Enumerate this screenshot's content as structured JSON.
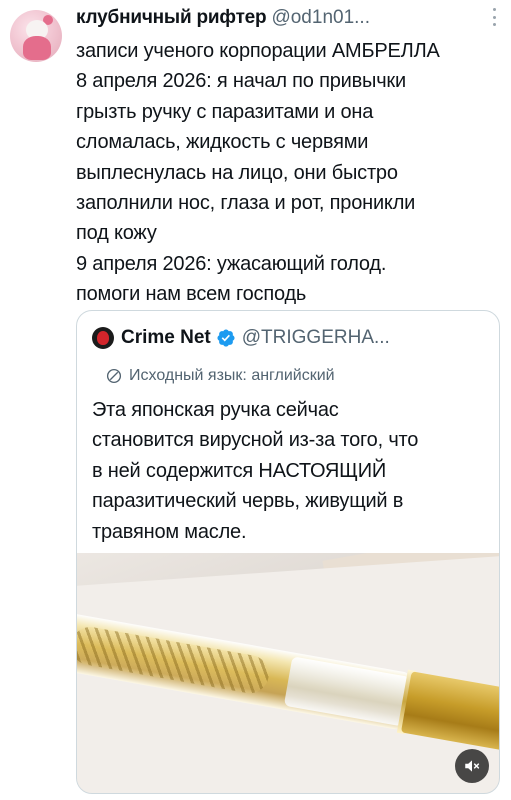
{
  "tweet": {
    "author_name": "клубничный рифтер",
    "author_handle": "@od1n01...",
    "text_lines": [
      "записи ученого корпорации АМБРЕЛЛА",
      "8 апреля 2026: я начал по привычки",
      "грызть ручку с паразитами и она",
      "сломалась, жидкость с червями",
      "выплеснулась на лицо, они быстро",
      "заполнили нос, глаза и рот, проникли",
      "под кожу",
      "9 апреля 2026: ужасающий голод.",
      "помоги нам всем господь"
    ]
  },
  "quote": {
    "author_name": "Crime Net",
    "author_handle": "@TRIGGERHA...",
    "translation_label": "Исходный язык: английский",
    "text_lines": [
      "Эта японская ручка сейчас",
      "становится вирусной из-за того, что",
      "в ней содержится НАСТОЯЩИЙ",
      "паразитический червь, живущий в",
      "травяном масле."
    ],
    "media": {
      "type": "video",
      "mute_icon": "mute-icon"
    }
  },
  "colors": {
    "text": "#0f1419",
    "secondary": "#536471",
    "border": "#cfd9de",
    "verified": "#1d9bf0"
  }
}
